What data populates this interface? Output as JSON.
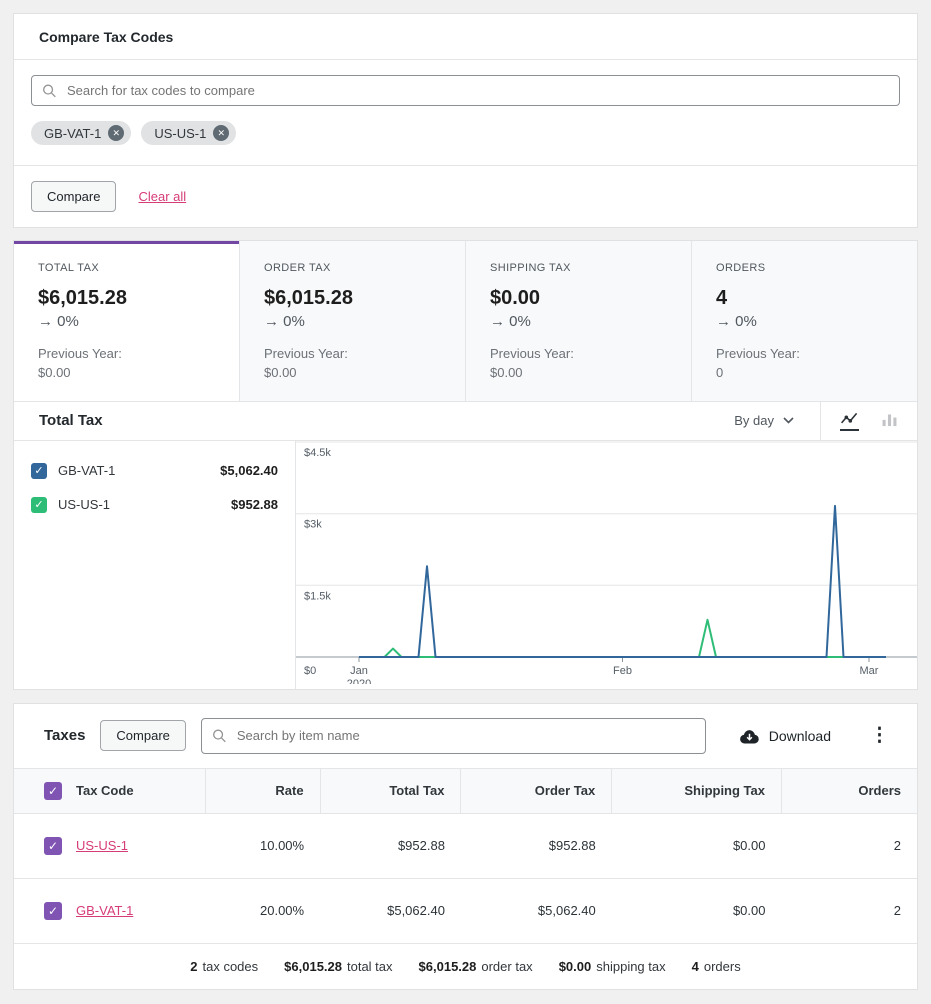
{
  "colors": {
    "accent_purple": "#7f54b3",
    "link_pink": "#d63c78",
    "series_blue": "#31679B",
    "series_green": "#2EBD77",
    "page_background": "#f0f0f1"
  },
  "compare_card": {
    "title": "Compare Tax Codes",
    "search_placeholder": "Search for tax codes to compare",
    "chips": [
      {
        "label": "GB-VAT-1"
      },
      {
        "label": "US-US-1"
      }
    ],
    "compare_button": "Compare",
    "clear_all_link": "Clear all"
  },
  "summary_tabs": [
    {
      "label": "TOTAL TAX",
      "value": "$6,015.28",
      "delta": "→ 0%",
      "previous_label": "Previous Year:",
      "previous_value": "$0.00"
    },
    {
      "label": "ORDER TAX",
      "value": "$6,015.28",
      "delta": "→ 0%",
      "previous_label": "Previous Year:",
      "previous_value": "$0.00"
    },
    {
      "label": "SHIPPING TAX",
      "value": "$0.00",
      "delta": "→ 0%",
      "previous_label": "Previous Year:",
      "previous_value": "$0.00"
    },
    {
      "label": "ORDERS",
      "value": "4",
      "delta": "→ 0%",
      "previous_label": "Previous Year:",
      "previous_value": "0"
    }
  ],
  "chart_section": {
    "title": "Total Tax",
    "interval_selector": "By day",
    "legend": [
      {
        "label": "GB-VAT-1",
        "total": "$5,062.40"
      },
      {
        "label": "US-US-1",
        "total": "$952.88"
      }
    ]
  },
  "chart_data": {
    "type": "line",
    "title": "Total Tax",
    "interval": "day",
    "x_start_date": "2020-01-01",
    "days": 62,
    "ylim": [
      0,
      4500
    ],
    "grid": true,
    "legend_position": "left",
    "x_ticks": [
      {
        "day": 0,
        "label": "Jan",
        "sublabel": "2020"
      },
      {
        "day": 31,
        "label": "Feb"
      },
      {
        "day": 60,
        "label": "Mar"
      }
    ],
    "y_ticks": [
      {
        "value": 0,
        "label": "$0"
      },
      {
        "value": 1500,
        "label": "$1.5k"
      },
      {
        "value": 3000,
        "label": "$3k"
      },
      {
        "value": 4500,
        "label": "$4.5k"
      }
    ],
    "series": [
      {
        "name": "GB-VAT-1",
        "color": "#31679B",
        "total": 5062.4,
        "other_days_value": 0,
        "points": [
          {
            "date": "2020-01-09",
            "day": 8,
            "value": 1900
          },
          {
            "date": "2020-02-26",
            "day": 56,
            "value": 3162
          }
        ]
      },
      {
        "name": "US-US-1",
        "color": "#2EBD77",
        "total": 952.88,
        "other_days_value": 0,
        "points": [
          {
            "date": "2020-01-05",
            "day": 4,
            "value": 175
          },
          {
            "date": "2020-02-11",
            "day": 41,
            "value": 778
          }
        ]
      }
    ]
  },
  "table_card": {
    "title": "Taxes",
    "compare_button": "Compare",
    "search_placeholder": "Search by item name",
    "download_button": "Download",
    "columns": [
      "Tax Code",
      "Rate",
      "Total Tax",
      "Order Tax",
      "Shipping Tax",
      "Orders"
    ],
    "rows": [
      {
        "tax_code": "US-US-1",
        "rate": "10.00%",
        "total_tax": "$952.88",
        "order_tax": "$952.88",
        "shipping_tax": "$0.00",
        "orders": "2"
      },
      {
        "tax_code": "GB-VAT-1",
        "rate": "20.00%",
        "total_tax": "$5,062.40",
        "order_tax": "$5,062.40",
        "shipping_tax": "$0.00",
        "orders": "2"
      }
    ],
    "summary": [
      {
        "value": "2",
        "label": "tax codes"
      },
      {
        "value": "$6,015.28",
        "label": "total tax"
      },
      {
        "value": "$6,015.28",
        "label": "order tax"
      },
      {
        "value": "$0.00",
        "label": "shipping tax"
      },
      {
        "value": "4",
        "label": "orders"
      }
    ]
  }
}
